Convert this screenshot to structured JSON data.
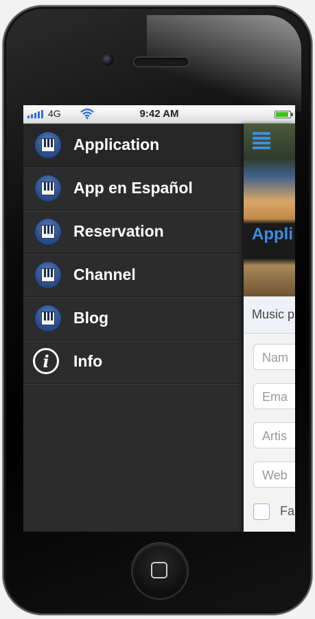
{
  "status_bar": {
    "carrier": "4G",
    "time": "9:42 AM",
    "icons": [
      "signal-icon",
      "wifi-icon",
      "battery-icon"
    ],
    "battery_level": 0.9
  },
  "menu": {
    "items": [
      {
        "label": "Application",
        "icon": "piano-icon"
      },
      {
        "label": "App en Español",
        "icon": "piano-icon"
      },
      {
        "label": "Reservation",
        "icon": "piano-icon"
      },
      {
        "label": "Channel",
        "icon": "piano-icon"
      },
      {
        "label": "Blog",
        "icon": "piano-icon"
      },
      {
        "label": "Info",
        "icon": "info-icon"
      }
    ]
  },
  "app_panel": {
    "menu_icon": "hamburger-icon",
    "title": "Appli",
    "subtitle": "Music p",
    "fields": [
      {
        "placeholder": "Nam"
      },
      {
        "placeholder": "Ema"
      },
      {
        "placeholder": "Artis"
      },
      {
        "placeholder": "Web"
      }
    ],
    "checkbox_label": "Fa"
  },
  "colors": {
    "accent": "#3c8ee0",
    "menu_bg": "#2c2c2c",
    "icon_blue": "#2c4e8a"
  }
}
